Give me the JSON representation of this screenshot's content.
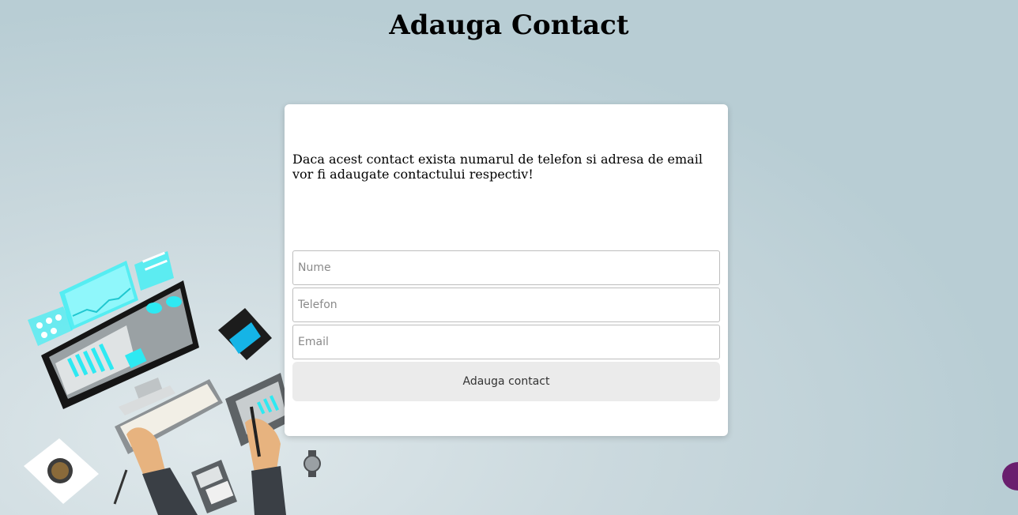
{
  "page": {
    "title": "Adauga Contact",
    "notice": "Daca acest contact exista numarul de telefon si adresa de email vor fi adaugate contactului respectiv!"
  },
  "form": {
    "name_placeholder": "Nume",
    "name_value": "",
    "phone_placeholder": "Telefon",
    "phone_value": "",
    "email_placeholder": "Email",
    "email_value": "",
    "submit_label": "Adauga contact"
  },
  "colors": {
    "background": "#b8cdd4",
    "card": "#ffffff",
    "button": "#ebebeb",
    "accent": "#00e5f0",
    "chat_bubble": "#6a1f6e"
  },
  "icons": {
    "illustration": "workspace-desk-illustration",
    "chat": "chat-bubble-icon"
  }
}
